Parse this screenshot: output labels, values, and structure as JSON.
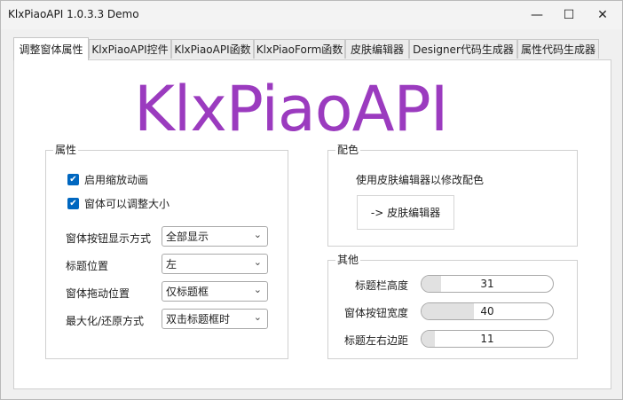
{
  "window": {
    "title": "KlxPiaoAPI 1.0.3.3 Demo",
    "minimize_glyph": "—",
    "maximize_glyph": "☐",
    "close_glyph": "✕"
  },
  "tabs": [
    {
      "label": "调整窗体属性",
      "active": true
    },
    {
      "label": "KlxPiaoAPI控件",
      "active": false
    },
    {
      "label": "KlxPiaoAPI函数",
      "active": false
    },
    {
      "label": "KlxPiaoForm函数",
      "active": false
    },
    {
      "label": "皮肤编辑器",
      "active": false
    },
    {
      "label": "Designer代码生成器",
      "active": false
    },
    {
      "label": "属性代码生成器",
      "active": false
    }
  ],
  "logo_text": "KlxPiaoAPI",
  "properties": {
    "legend": "属性",
    "checkboxes": [
      {
        "label": "启用缩放动画",
        "checked": true
      },
      {
        "label": "窗体可以调整大小",
        "checked": true
      }
    ],
    "fields": [
      {
        "label": "窗体按钮显示方式",
        "value": "全部显示"
      },
      {
        "label": "标题位置",
        "value": "左"
      },
      {
        "label": "窗体拖动位置",
        "value": "仅标题框"
      },
      {
        "label": "最大化/还原方式",
        "value": "双击标题框时"
      }
    ]
  },
  "colors": {
    "legend": "配色",
    "hint": "使用皮肤编辑器以修改配色",
    "button_label": "-> 皮肤编辑器"
  },
  "other": {
    "legend": "其他",
    "sliders": [
      {
        "label": "标题栏高度",
        "value": "31",
        "fill_fraction": 0.15
      },
      {
        "label": "窗体按钮宽度",
        "value": "40",
        "fill_fraction": 0.4
      },
      {
        "label": "标题左右边距",
        "value": "11",
        "fill_fraction": 0.1
      }
    ]
  },
  "accent_colors": {
    "logo": "#9b3bbf",
    "checkbox": "#0067c0"
  },
  "icons": {
    "checkbox_check": "✔",
    "select_chevron": "⌵"
  }
}
